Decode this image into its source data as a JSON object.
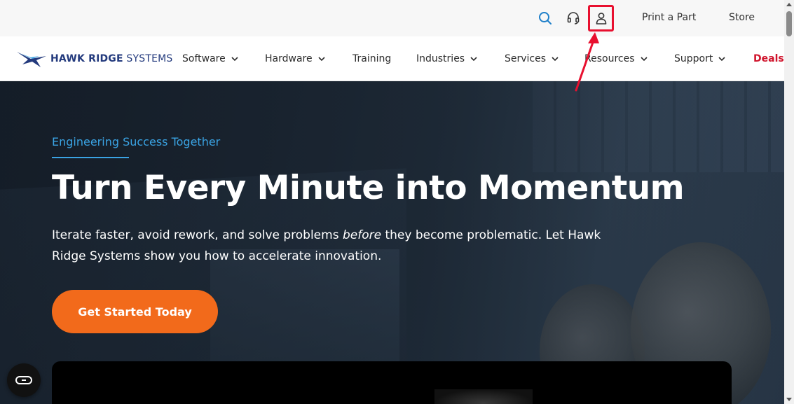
{
  "utility_bar": {
    "icons": [
      "search-icon",
      "headset-icon",
      "user-icon"
    ],
    "links": [
      "Print a Part",
      "Store"
    ]
  },
  "logo": {
    "brand_bold": "HAWK RIDGE",
    "brand_light": "SYSTEMS"
  },
  "nav": {
    "items": [
      {
        "label": "Software",
        "has_dropdown": true
      },
      {
        "label": "Hardware",
        "has_dropdown": true
      },
      {
        "label": "Training",
        "has_dropdown": false
      },
      {
        "label": "Industries",
        "has_dropdown": true
      },
      {
        "label": "Services",
        "has_dropdown": true
      },
      {
        "label": "Resources",
        "has_dropdown": true
      },
      {
        "label": "Support",
        "has_dropdown": true
      },
      {
        "label": "Deals",
        "has_dropdown": false
      }
    ],
    "deals_color": "#d0142c"
  },
  "hero": {
    "eyebrow": "Engineering Success Together",
    "title": "Turn Every Minute into Momentum",
    "desc_before": "Iterate faster, avoid rework, and solve problems ",
    "desc_em": "before",
    "desc_after": " they become problematic. Let Hawk Ridge Systems show you how to accelerate innovation.",
    "cta_label": "Get Started Today"
  },
  "colors": {
    "accent_blue": "#3aa3e3",
    "cta_orange": "#f26a1b",
    "annotation_red": "#e8102f",
    "brand_navy": "#233a7d"
  }
}
